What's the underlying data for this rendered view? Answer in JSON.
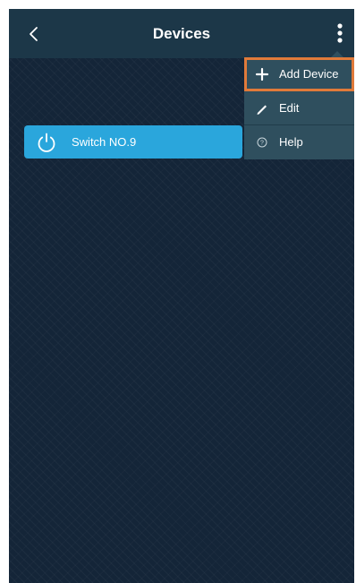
{
  "header": {
    "title": "Devices"
  },
  "devices": [
    {
      "name": "Switch NO.9"
    }
  ],
  "menu": {
    "items": [
      {
        "label": "Add Device",
        "icon": "plus-icon",
        "highlighted": true
      },
      {
        "label": "Edit",
        "icon": "pencil-icon",
        "highlighted": false
      },
      {
        "label": "Help",
        "icon": "help-circle-icon",
        "highlighted": false
      }
    ]
  },
  "colors": {
    "background": "#142538",
    "topbar": "#1c3748",
    "device_tile": "#2aa6dc",
    "menu_bg": "#2f4f5e",
    "highlight": "#e07a3a"
  }
}
